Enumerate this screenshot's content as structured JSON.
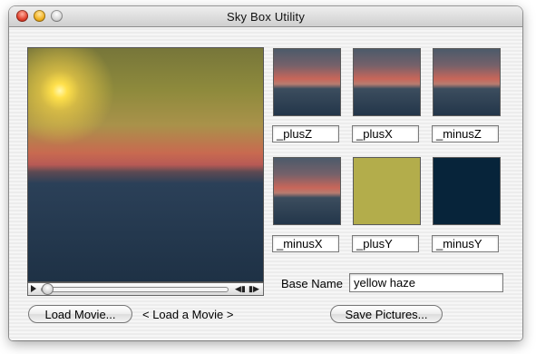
{
  "window": {
    "title": "Sky Box Utility",
    "controls": [
      "close-button",
      "minimize-button",
      "zoom-button"
    ]
  },
  "movie": {
    "playhead_fraction": 0
  },
  "faces": [
    {
      "name": "_plusZ",
      "image": "sky-horizon"
    },
    {
      "name": "_plusX",
      "image": "sky-horizon"
    },
    {
      "name": "_minusZ",
      "image": "sky-horizon"
    },
    {
      "name": "_minusX",
      "image": "sky-horizon"
    },
    {
      "name": "_plusY",
      "image": "solid",
      "color": "#b3ad4b"
    },
    {
      "name": "_minusY",
      "image": "solid",
      "color": "#07243a"
    }
  ],
  "base_name": {
    "label": "Base Name",
    "value": "yellow haze"
  },
  "buttons": {
    "load_movie": "Load Movie...",
    "save_pictures": "Save Pictures..."
  },
  "status": "< Load a Movie >"
}
